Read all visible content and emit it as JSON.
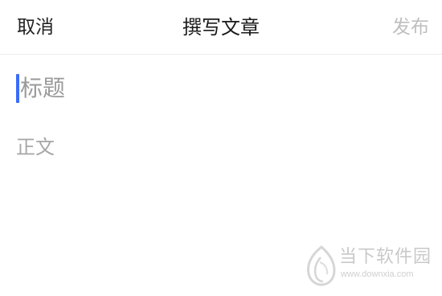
{
  "header": {
    "cancel_label": "取消",
    "title": "撰写文章",
    "publish_label": "发布"
  },
  "editor": {
    "title_placeholder": "标题",
    "body_placeholder": "正文",
    "caret_color": "#3b6cf6"
  },
  "watermark": {
    "brand": "当下软件园",
    "url": "www.downxia.com"
  },
  "colors": {
    "accent": "#3b6cf6",
    "disabled_text": "#bfbfbf",
    "placeholder_text": "#9a9a9a"
  }
}
